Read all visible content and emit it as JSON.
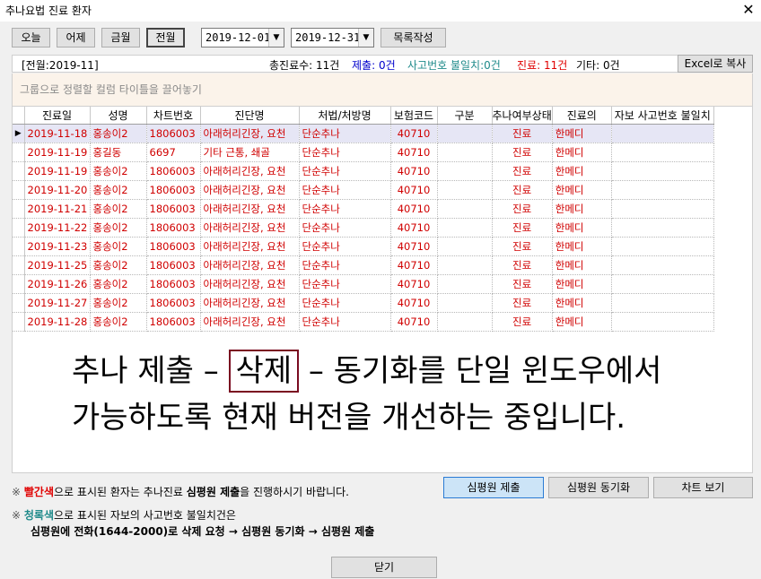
{
  "window": {
    "title": "추나요법 진료 환자",
    "close_glyph": "✕"
  },
  "toolbar": {
    "today": "오늘",
    "yesterday": "어제",
    "this_month": "금월",
    "last_month": "전월",
    "date_from": "2019-12-01",
    "date_to": "2019-12-31",
    "make_list": "목록작성",
    "excel_copy": "Excel로 복사"
  },
  "status": {
    "period": "[전월:2019-11]",
    "total": "총진료수: 11건",
    "submitted": "제출: 0건",
    "mismatch": "사고번호 불일치:0건",
    "treated": "진료: 11건",
    "other": "기타: 0건"
  },
  "group_hint": "그룹으로 정렬할 컬럼 타이틀을 끌어놓기",
  "columns": [
    "진료일",
    "성명",
    "차트번호",
    "진단명",
    "처법/처방명",
    "보험코드",
    "구분",
    "추나여부상태",
    "진료의",
    "자보 사고번호 불일치"
  ],
  "rows": [
    [
      "2019-11-18",
      "홍송이2",
      "1806003",
      "아래허리긴장, 요천",
      "단순추나",
      "40710",
      "",
      "진료",
      "한메디",
      ""
    ],
    [
      "2019-11-19",
      "홍길동",
      "6697",
      "기타 근통, 쇄골",
      "단순추나",
      "40710",
      "",
      "진료",
      "한메디",
      ""
    ],
    [
      "2019-11-19",
      "홍송이2",
      "1806003",
      "아래허리긴장, 요천",
      "단순추나",
      "40710",
      "",
      "진료",
      "한메디",
      ""
    ],
    [
      "2019-11-20",
      "홍송이2",
      "1806003",
      "아래허리긴장, 요천",
      "단순추나",
      "40710",
      "",
      "진료",
      "한메디",
      ""
    ],
    [
      "2019-11-21",
      "홍송이2",
      "1806003",
      "아래허리긴장, 요천",
      "단순추나",
      "40710",
      "",
      "진료",
      "한메디",
      ""
    ],
    [
      "2019-11-22",
      "홍송이2",
      "1806003",
      "아래허리긴장, 요천",
      "단순추나",
      "40710",
      "",
      "진료",
      "한메디",
      ""
    ],
    [
      "2019-11-23",
      "홍송이2",
      "1806003",
      "아래허리긴장, 요천",
      "단순추나",
      "40710",
      "",
      "진료",
      "한메디",
      ""
    ],
    [
      "2019-11-25",
      "홍송이2",
      "1806003",
      "아래허리긴장, 요천",
      "단순추나",
      "40710",
      "",
      "진료",
      "한메디",
      ""
    ],
    [
      "2019-11-26",
      "홍송이2",
      "1806003",
      "아래허리긴장, 요천",
      "단순추나",
      "40710",
      "",
      "진료",
      "한메디",
      ""
    ],
    [
      "2019-11-27",
      "홍송이2",
      "1806003",
      "아래허리긴장, 요천",
      "단순추나",
      "40710",
      "",
      "진료",
      "한메디",
      ""
    ],
    [
      "2019-11-28",
      "홍송이2",
      "1806003",
      "아래허리긴장, 요천",
      "단순추나",
      "40710",
      "",
      "진료",
      "한메디",
      ""
    ]
  ],
  "overlay": {
    "line1_pre": "추나 제출 – ",
    "line1_box": "삭제",
    "line1_post": " – 동기화를 단일 윈도우에서",
    "line2": "가능하도록 현재 버전을 개선하는 중입니다."
  },
  "notes": {
    "note1_sym": "※",
    "note1_color": "빨간색",
    "note1_mid": "으로 표시된 환자는 추나진료 ",
    "note1_bold": "심평원 제출",
    "note1_end": "을 진행하시기 바랍니다.",
    "note2_sym": "※",
    "note2_color": "청록색",
    "note2_end": "으로 표시된 자보의 사고번호 불일치건은",
    "note3": "심평원에 전화(1644-2000)로 삭제 요청 → 심평원 동기화 → 심평원 제출"
  },
  "actions": {
    "submit": "심평원 제출",
    "sync": "심평원 동기화",
    "chart": "차트 보기",
    "close": "닫기"
  },
  "colors": {
    "row_text": "#d00000",
    "submitted": "#0000cc",
    "mismatch": "#1f8a8a",
    "treated": "#e00000",
    "overlay_box": "#7a0b20"
  },
  "icons": {
    "row_indicator": "▶",
    "dropdown": "▼"
  }
}
